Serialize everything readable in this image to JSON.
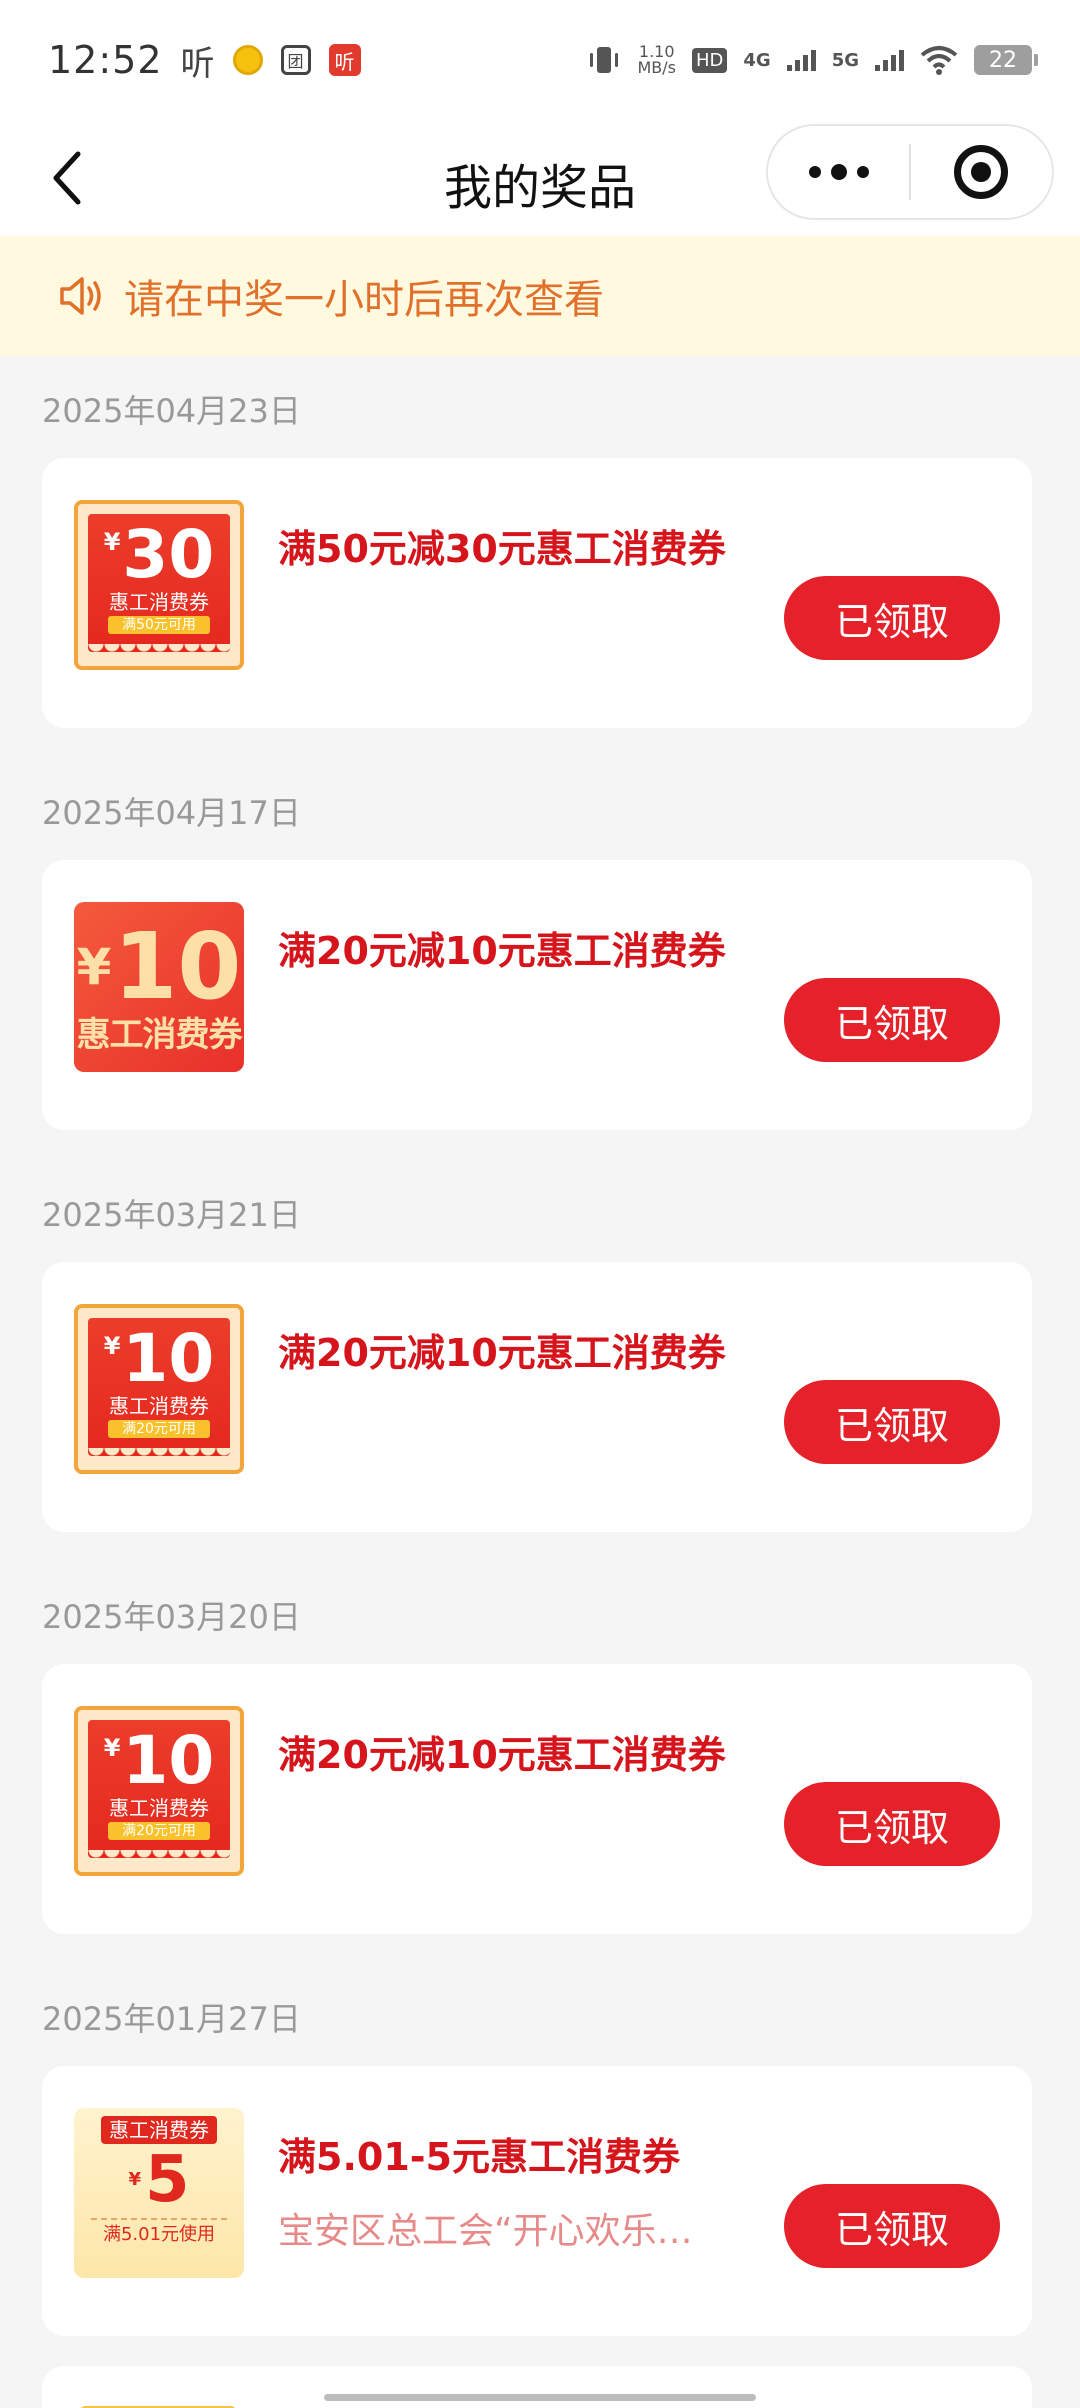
{
  "status_bar": {
    "time": "12:52",
    "app_label": "听",
    "red_badge": "听",
    "square_badge": "团",
    "speed_value": "1.10",
    "speed_unit": "MB/s",
    "hd_label": "HD",
    "net_4g": "4G",
    "net_5g": "5G",
    "battery": "22"
  },
  "nav": {
    "title": "我的奖品"
  },
  "notice": {
    "text": "请在中奖一小时后再次查看",
    "color": "#e0702a"
  },
  "prizes": [
    {
      "date": "2025年04月23日",
      "title": "满50元减30元惠工消费券",
      "subtitle": "",
      "button": "已领取",
      "thumb": {
        "style": "a",
        "currency": "¥",
        "amount": "30",
        "name": "惠工消费券",
        "condition": "满50元可用"
      }
    },
    {
      "date": "2025年04月17日",
      "title": "满20元减10元惠工消费券",
      "subtitle": "",
      "button": "已领取",
      "thumb": {
        "style": "b",
        "currency": "¥",
        "amount": "10",
        "name": "惠工消费券"
      }
    },
    {
      "date": "2025年03月21日",
      "title": "满20元减10元惠工消费券",
      "subtitle": "",
      "button": "已领取",
      "thumb": {
        "style": "a",
        "currency": "¥",
        "amount": "10",
        "name": "惠工消费券",
        "condition": "满20元可用"
      }
    },
    {
      "date": "2025年03月20日",
      "title": "满20元减10元惠工消费券",
      "subtitle": "",
      "button": "已领取",
      "thumb": {
        "style": "a",
        "currency": "¥",
        "amount": "10",
        "name": "惠工消费券",
        "condition": "满20元可用"
      }
    },
    {
      "date": "2025年01月27日",
      "title": "满5.01-5元惠工消费券",
      "subtitle": "宝安区总工会“开心欢乐…",
      "button": "已领取",
      "thumb": {
        "style": "c",
        "currency": "¥",
        "amount": "5",
        "name": "惠工消费券",
        "condition": "满5.01元使用"
      }
    }
  ],
  "colors": {
    "accent_red": "#e5222a",
    "title_red": "#d6141c",
    "notice_bg": "#fff9e0"
  }
}
